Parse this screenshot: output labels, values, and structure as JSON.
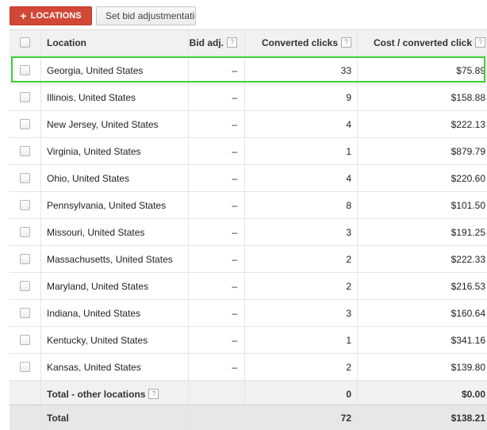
{
  "toolbar": {
    "add_label": "LOCATIONS",
    "set_bid_label": "Set bid adjustmentation"
  },
  "table": {
    "headers": {
      "location": "Location",
      "bid_adj": "Bid adj.",
      "converted_clicks": "Converted clicks",
      "cost_per_click": "Cost / converted click"
    },
    "help_glyph": "?",
    "rows": [
      {
        "location": "Georgia, United States",
        "bid_adj": "–",
        "clicks": "33",
        "cost": "$75.89"
      },
      {
        "location": "Illinois, United States",
        "bid_adj": "–",
        "clicks": "9",
        "cost": "$158.88"
      },
      {
        "location": "New Jersey, United States",
        "bid_adj": "–",
        "clicks": "4",
        "cost": "$222.13"
      },
      {
        "location": "Virginia, United States",
        "bid_adj": "–",
        "clicks": "1",
        "cost": "$879.79"
      },
      {
        "location": "Ohio, United States",
        "bid_adj": "–",
        "clicks": "4",
        "cost": "$220.60"
      },
      {
        "location": "Pennsylvania, United States",
        "bid_adj": "–",
        "clicks": "8",
        "cost": "$101.50"
      },
      {
        "location": "Missouri, United States",
        "bid_adj": "–",
        "clicks": "3",
        "cost": "$191.25"
      },
      {
        "location": "Massachusetts, United States",
        "bid_adj": "–",
        "clicks": "2",
        "cost": "$222.33"
      },
      {
        "location": "Maryland, United States",
        "bid_adj": "–",
        "clicks": "2",
        "cost": "$216.53"
      },
      {
        "location": "Indiana, United States",
        "bid_adj": "–",
        "clicks": "3",
        "cost": "$160.64"
      },
      {
        "location": "Kentucky, United States",
        "bid_adj": "–",
        "clicks": "1",
        "cost": "$341.16"
      },
      {
        "location": "Kansas, United States",
        "bid_adj": "–",
        "clicks": "2",
        "cost": "$139.80"
      }
    ],
    "other": {
      "label": "Total - other locations",
      "clicks": "0",
      "cost": "$0.00"
    },
    "total": {
      "label": "Total",
      "clicks": "72",
      "cost": "$138.21"
    }
  },
  "colors": {
    "add_button": "#d14836",
    "highlight": "#39cf31"
  }
}
